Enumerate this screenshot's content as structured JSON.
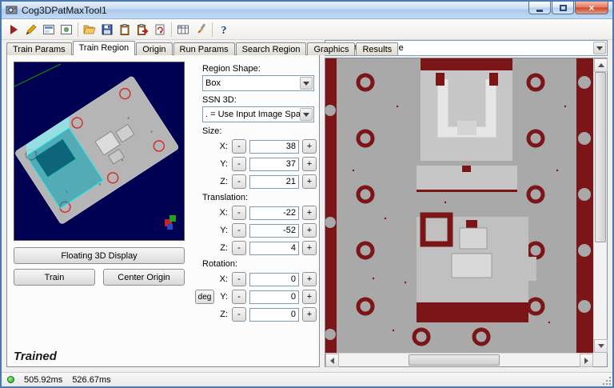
{
  "window": {
    "title": "Cog3DPatMaxTool1",
    "glyphs": {
      "close": "×"
    }
  },
  "toolbar": {
    "icons": [
      "run",
      "electric-run",
      "show-result-display",
      "show-image-display",
      "open",
      "save",
      "copy",
      "paste",
      "reset",
      "expression",
      "paint",
      "help"
    ],
    "help_glyph": "?"
  },
  "tabs": [
    "Train Params",
    "Train Region",
    "Origin",
    "Run Params",
    "Search Region",
    "Graphics",
    "Results"
  ],
  "train_region": {
    "floating_button": "Floating 3D Display",
    "train_button": "Train",
    "center_origin_button": "Center Origin",
    "region_shape_label": "Region Shape:",
    "region_shape_value": "Box",
    "ssn_label": "SSN 3D:",
    "ssn_value": ". = Use Input Image Space",
    "size_label": "Size:",
    "translation_label": "Translation:",
    "rotation_label": "Rotation:",
    "axis_x": "X:",
    "axis_y": "Y:",
    "axis_z": "Z:",
    "minus": "-",
    "plus": "+",
    "deg_button": "deg",
    "size": {
      "x": "38",
      "y": "37",
      "z": "21"
    },
    "translation": {
      "x": "-22",
      "y": "-52",
      "z": "4"
    },
    "rotation": {
      "x": "0",
      "y": "0",
      "z": "0"
    },
    "trained_status": "Trained"
  },
  "image_panel": {
    "source": "Current.InputImage"
  },
  "status_bar": {
    "time1": "505.92ms",
    "time2": "526.67ms"
  }
}
